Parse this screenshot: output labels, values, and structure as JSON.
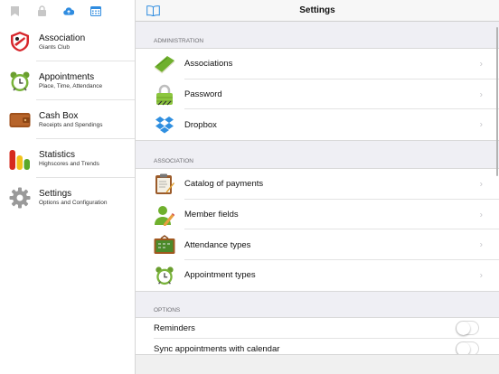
{
  "sidebar": {
    "toolbar": [
      {
        "icon": "bookmark-icon"
      },
      {
        "icon": "lock-icon"
      },
      {
        "icon": "cloud-upload-icon"
      },
      {
        "icon": "calendar-icon"
      }
    ],
    "items": [
      {
        "title": "Association",
        "subtitle": "Giants Club",
        "icon": "club-logo-icon"
      },
      {
        "title": "Appointments",
        "subtitle": "Place, Time, Attendance",
        "icon": "alarm-clock-icon"
      },
      {
        "title": "Cash Box",
        "subtitle": "Receipts and Spendings",
        "icon": "wallet-icon"
      },
      {
        "title": "Statistics",
        "subtitle": "Highscores and Trends",
        "icon": "bar-chart-icon"
      },
      {
        "title": "Settings",
        "subtitle": "Options and Configuration",
        "icon": "gear-icon"
      }
    ]
  },
  "header": {
    "title": "Settings"
  },
  "sections": {
    "administration": {
      "header": "ADMINISTRATION",
      "rows": [
        {
          "label": "Associations",
          "icon": "book-icon"
        },
        {
          "label": "Password",
          "icon": "padlock-icon"
        },
        {
          "label": "Dropbox",
          "icon": "dropbox-icon"
        }
      ]
    },
    "association": {
      "header": "ASSOCIATION",
      "rows": [
        {
          "label": "Catalog of payments",
          "icon": "clipboard-icon"
        },
        {
          "label": "Member fields",
          "icon": "member-edit-icon"
        },
        {
          "label": "Attendance types",
          "icon": "chalkboard-icon"
        },
        {
          "label": "Appointment types",
          "icon": "alarm-clock-icon"
        }
      ]
    },
    "options": {
      "header": "OPTIONS",
      "rows": [
        {
          "label": "Reminders",
          "toggle": false
        },
        {
          "label": "Sync appointments with calendar",
          "toggle": false
        }
      ]
    }
  },
  "colors": {
    "accent": "#2f8ce0",
    "background": "#efeff4"
  }
}
